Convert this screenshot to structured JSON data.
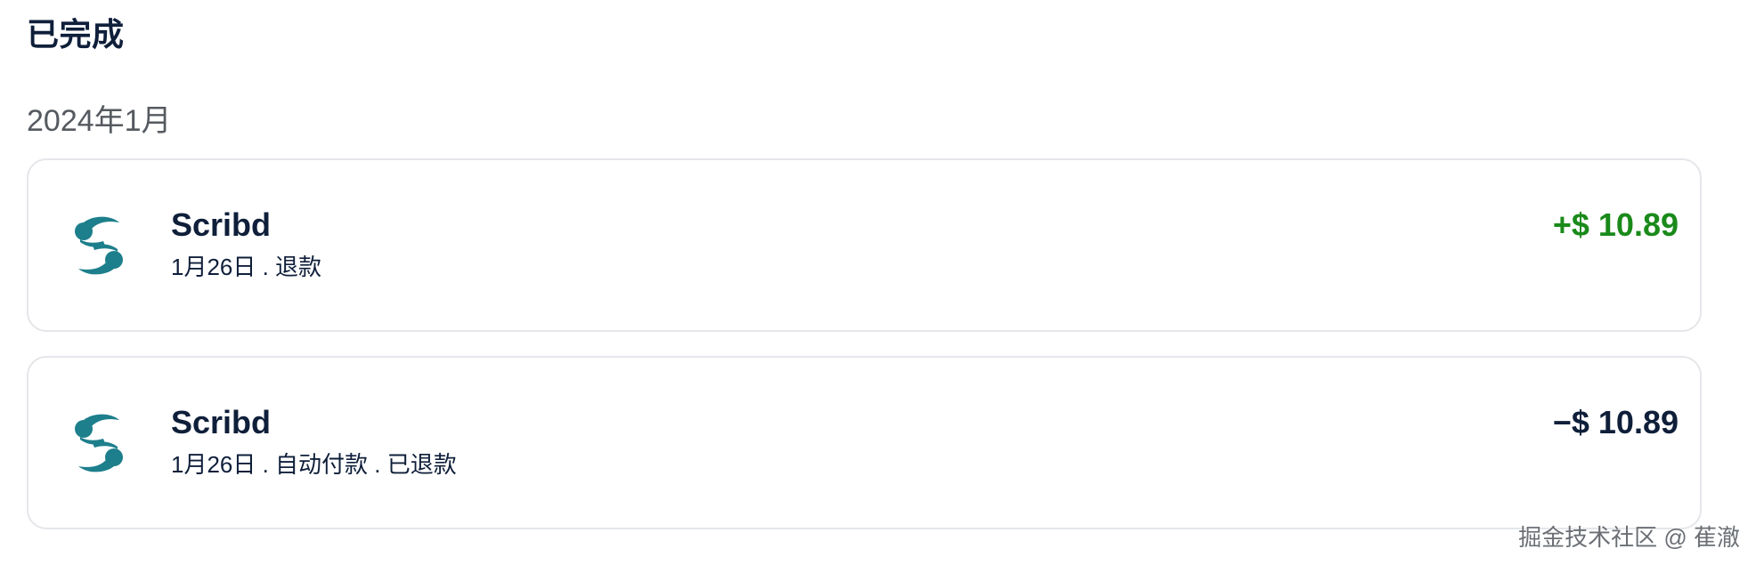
{
  "section": {
    "title": "已完成"
  },
  "month": {
    "label": "2024年1月"
  },
  "transactions": [
    {
      "merchant": "Scribd",
      "meta": "1月26日 . 退款",
      "amount": "+$ 10.89",
      "amount_color": "#1a8a1a",
      "icon": "scribd-logo-icon"
    },
    {
      "merchant": "Scribd",
      "meta": "1月26日 . 自动付款 . 已退款",
      "amount": "−$ 10.89",
      "amount_color": "#0f1f3a",
      "icon": "scribd-logo-icon"
    }
  ],
  "brand_colors": {
    "scribd": "#1e7f8c",
    "positive": "#1a8a1a",
    "text": "#0f1f3a"
  },
  "watermark": {
    "text": "掘金技术社区 @ 萑澈"
  }
}
